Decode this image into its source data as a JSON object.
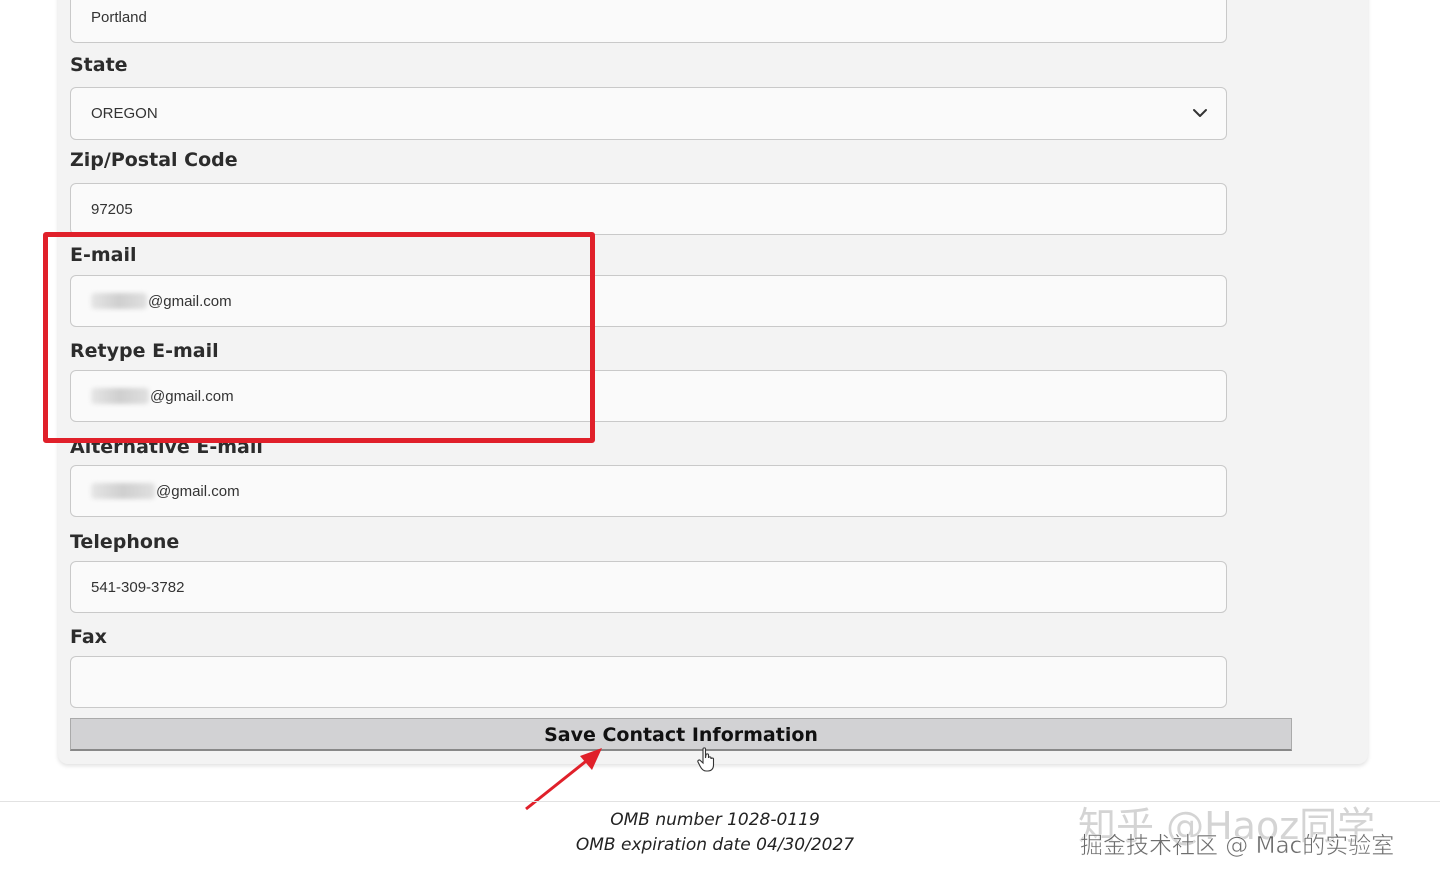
{
  "form": {
    "city_value": "Portland",
    "state_label": "State",
    "state_value": "OREGON",
    "zip_label": "Zip/Postal Code",
    "zip_value": "97205",
    "email_label": "E-mail",
    "email_value": "@gmail.com",
    "retype_email_label": "Retype E-mail",
    "retype_email_value": "@gmail.com",
    "alt_email_label": "Alternative E-mail",
    "alt_email_value": "@gmail.com",
    "telephone_label": "Telephone",
    "telephone_value": "541-309-3782",
    "fax_label": "Fax",
    "fax_value": "",
    "save_label": "Save Contact Information"
  },
  "footer": {
    "omb_number": "OMB number 1028-0119",
    "omb_expiration": "OMB expiration date 04/30/2027"
  },
  "watermarks": {
    "line1": "知乎 @Haoz同学",
    "line2": "掘金技术社区 @ Mac的实验室"
  },
  "annotation": {
    "highlight_color": "#e0202a"
  }
}
